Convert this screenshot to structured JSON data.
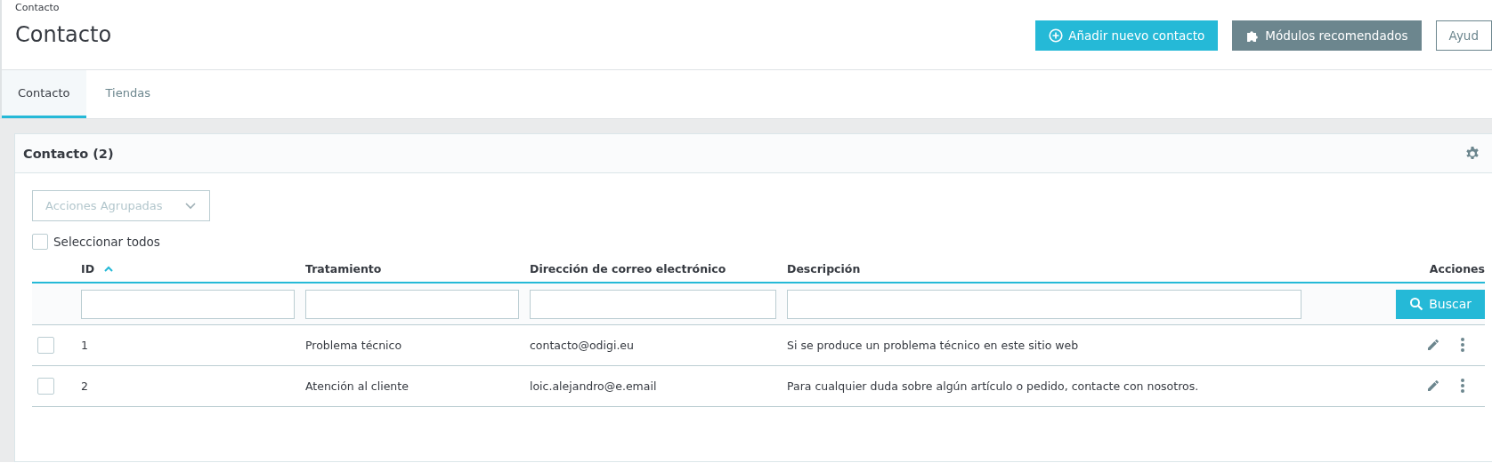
{
  "breadcrumb": "Contacto",
  "title": "Contacto",
  "toolbar_buttons": [
    {
      "label": "Añadir nuevo contacto",
      "kind": "primary"
    },
    {
      "label": "Módulos recomendados",
      "kind": "secondary"
    },
    {
      "label": "Ayud",
      "kind": "outline"
    }
  ],
  "tabs": [
    {
      "label": "Contacto",
      "selected": true
    },
    {
      "label": "Tiendas",
      "selected": false
    }
  ],
  "panel": {
    "title": "Contacto (2)",
    "bulk_actions": {
      "label": "Acciones Agrupadas",
      "disabled": true
    },
    "select_all": {
      "label": "Seleccionar todos",
      "checked": false
    },
    "table": {
      "columns": [
        {
          "label": "ID",
          "sorted": true
        },
        {
          "label": "Tratamiento",
          "sorted": false
        },
        {
          "label": "Dirección de correo electrónico",
          "sorted": false
        },
        {
          "label": "Descripción",
          "sorted": false
        },
        {
          "label": "Acciones",
          "sorted": false
        }
      ],
      "search_button": "Buscar",
      "rows": [
        {
          "checked": false,
          "cells": [
            "1",
            "Problema técnico",
            "contacto@odigi.eu",
            "Si se produce un problema técnico en este sitio web"
          ]
        },
        {
          "checked": false,
          "cells": [
            "2",
            "Atención al cliente",
            "loic.alejandro@e.email",
            "Para cualquier duda sobre algún artículo o pedido, contacte con nosotros."
          ]
        }
      ]
    }
  }
}
